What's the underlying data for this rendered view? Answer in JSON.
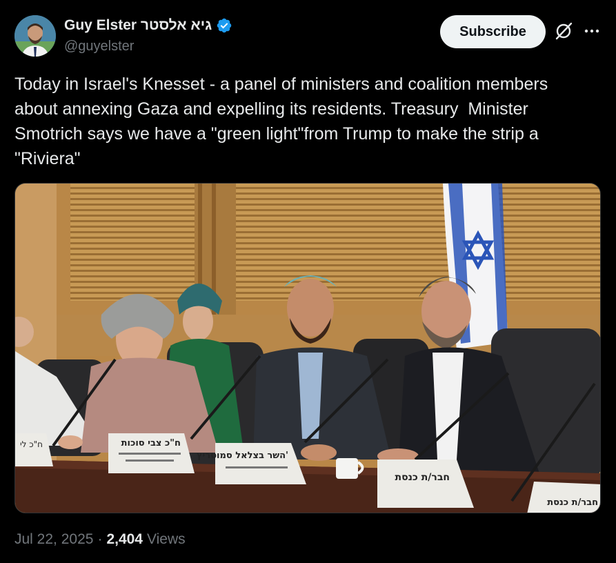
{
  "author": {
    "display_name": "Guy Elster גיא אלסטר",
    "handle": "@guyelster",
    "verified": true
  },
  "actions": {
    "subscribe_label": "Subscribe",
    "grok_icon": "grok-slash-circle-icon",
    "more_icon": "more-dots-icon"
  },
  "tweet": {
    "text": "Today in Israel's Knesset - a panel of ministers and coalition members\nabout annexing Gaza and expelling its residents. Treasury  Minister\nSmotrich says we have a \"green light\"from Trump to make the strip a\n\"Riviera\""
  },
  "media": {
    "placards": {
      "p1": "ח\"כ לי",
      "p2": "ח\"כ צבי סוכות",
      "p3": "השר בצלאל סמוטריץ'",
      "p4": "חבר/ת כנסת",
      "p5": "חבר/ת כנסת"
    }
  },
  "meta": {
    "date": "Jul 22, 2025",
    "separator": "·",
    "views_count": "2,404",
    "views_label": "Views"
  },
  "colors": {
    "background": "#000000",
    "text_primary": "#e7e9ea",
    "text_secondary": "#71767b",
    "verified_blue": "#1d9bf0",
    "subscribe_bg": "#eff3f4"
  }
}
